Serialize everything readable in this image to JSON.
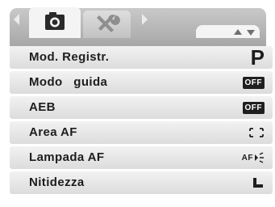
{
  "tabs": [
    {
      "name": "camera",
      "icon": "camera-icon",
      "active": true
    },
    {
      "name": "setup",
      "icon": "wrench-icon",
      "active": false
    }
  ],
  "menu": {
    "items": [
      {
        "label": "Mod. Registr.",
        "value": "P",
        "kind": "text-big"
      },
      {
        "label": "Modo   guida",
        "value": "OFF",
        "kind": "badge"
      },
      {
        "label": "AEB",
        "value": "OFF",
        "kind": "badge"
      },
      {
        "label": "Area AF",
        "value": "[ ]",
        "kind": "af-area-icon"
      },
      {
        "label": "Lampada AF",
        "value": "AF",
        "kind": "af-lamp-icon"
      },
      {
        "label": "Nitidezza",
        "value": "",
        "kind": "sharpness-icon"
      }
    ]
  },
  "colors": {
    "row_bg": "#e8e8e8",
    "tabbar_bg": "#b8b8b8",
    "text": "#1d1d1d"
  }
}
